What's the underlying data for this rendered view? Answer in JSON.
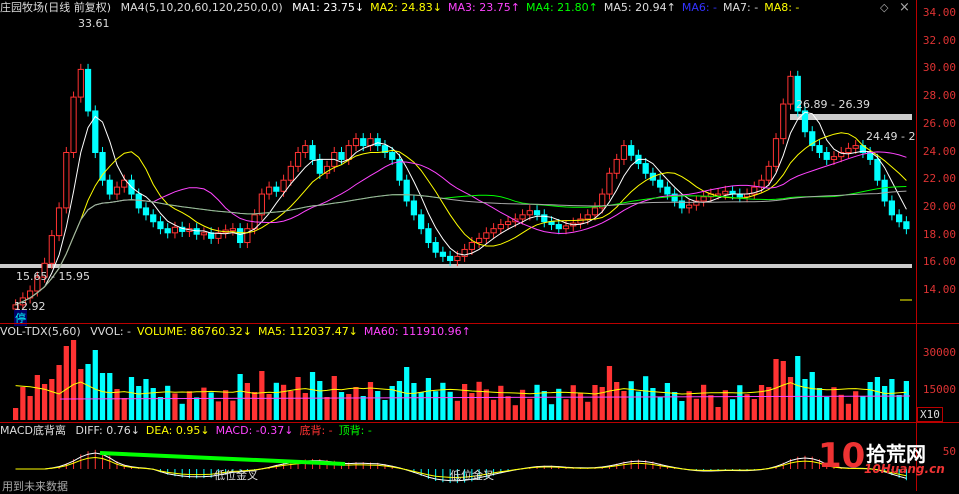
{
  "main": {
    "title": "庄园牧场(日线 前复权)",
    "ma_label": "MA4(5,10,20,60,120,250,0,0)",
    "ma_values": [
      {
        "label": "MA1: 23.75",
        "arrow": "↓",
        "color": "#ffffff"
      },
      {
        "label": "MA2: 24.83",
        "arrow": "↓",
        "color": "#ffff00"
      },
      {
        "label": "MA3: 23.75",
        "arrow": "↑",
        "color": "#ff44ff"
      },
      {
        "label": "MA4: 21.80",
        "arrow": "↑",
        "color": "#00ff00"
      },
      {
        "label": "MA5: 20.94",
        "arrow": "↑",
        "color": "#dddddd"
      },
      {
        "label": "MA6: -",
        "arrow": "",
        "color": "#3333ff"
      },
      {
        "label": "MA7: -",
        "arrow": "",
        "color": "#dddddd"
      },
      {
        "label": "MA8: -",
        "arrow": "",
        "color": "#ffff00"
      }
    ],
    "y_ticks": [
      "34.00",
      "32.00",
      "30.00",
      "28.00",
      "26.00",
      "24.00",
      "22.00",
      "20.00",
      "18.00",
      "16.00",
      "14.00"
    ],
    "annotations": {
      "high": "33.61",
      "low": "12.92",
      "band_low": "15.65 - 15.95",
      "band_high": "26.89 - 26.39",
      "band_right": "24.49 - 2",
      "stop_marker": "停"
    },
    "controls": {
      "diamond": "◇",
      "close": "×"
    }
  },
  "volume": {
    "label": "VOL-TDX(5,60)",
    "items": [
      {
        "text": "VVOL: -",
        "color": "#dddddd"
      },
      {
        "text": "VOLUME: 86760.32↓",
        "color": "#ffff00"
      },
      {
        "text": "MA5: 112037.47↓",
        "color": "#ffff00"
      },
      {
        "text": "MA60: 111910.96↑",
        "color": "#ff44ff"
      }
    ],
    "y_ticks": [
      "30000",
      "15000"
    ],
    "unit": "X10"
  },
  "macd": {
    "label": "MACD底背离",
    "items": [
      {
        "text": "DIFF: 0.76↓",
        "color": "#dddddd"
      },
      {
        "text": "DEA: 0.95↓",
        "color": "#ffff00"
      },
      {
        "text": "MACD: -0.37↓",
        "color": "#ff44ff"
      },
      {
        "text": "底背: -",
        "color": "#ff3333"
      },
      {
        "text": "顶背: -",
        "color": "#00ff00"
      }
    ],
    "y_ticks": [
      "50"
    ],
    "annotations": [
      "低位金叉",
      "低位金叉"
    ],
    "footer": "用到未来数据"
  },
  "watermark": {
    "brand": "拾荒网",
    "sub": "10Huang.cn",
    "digit": "10"
  }
}
